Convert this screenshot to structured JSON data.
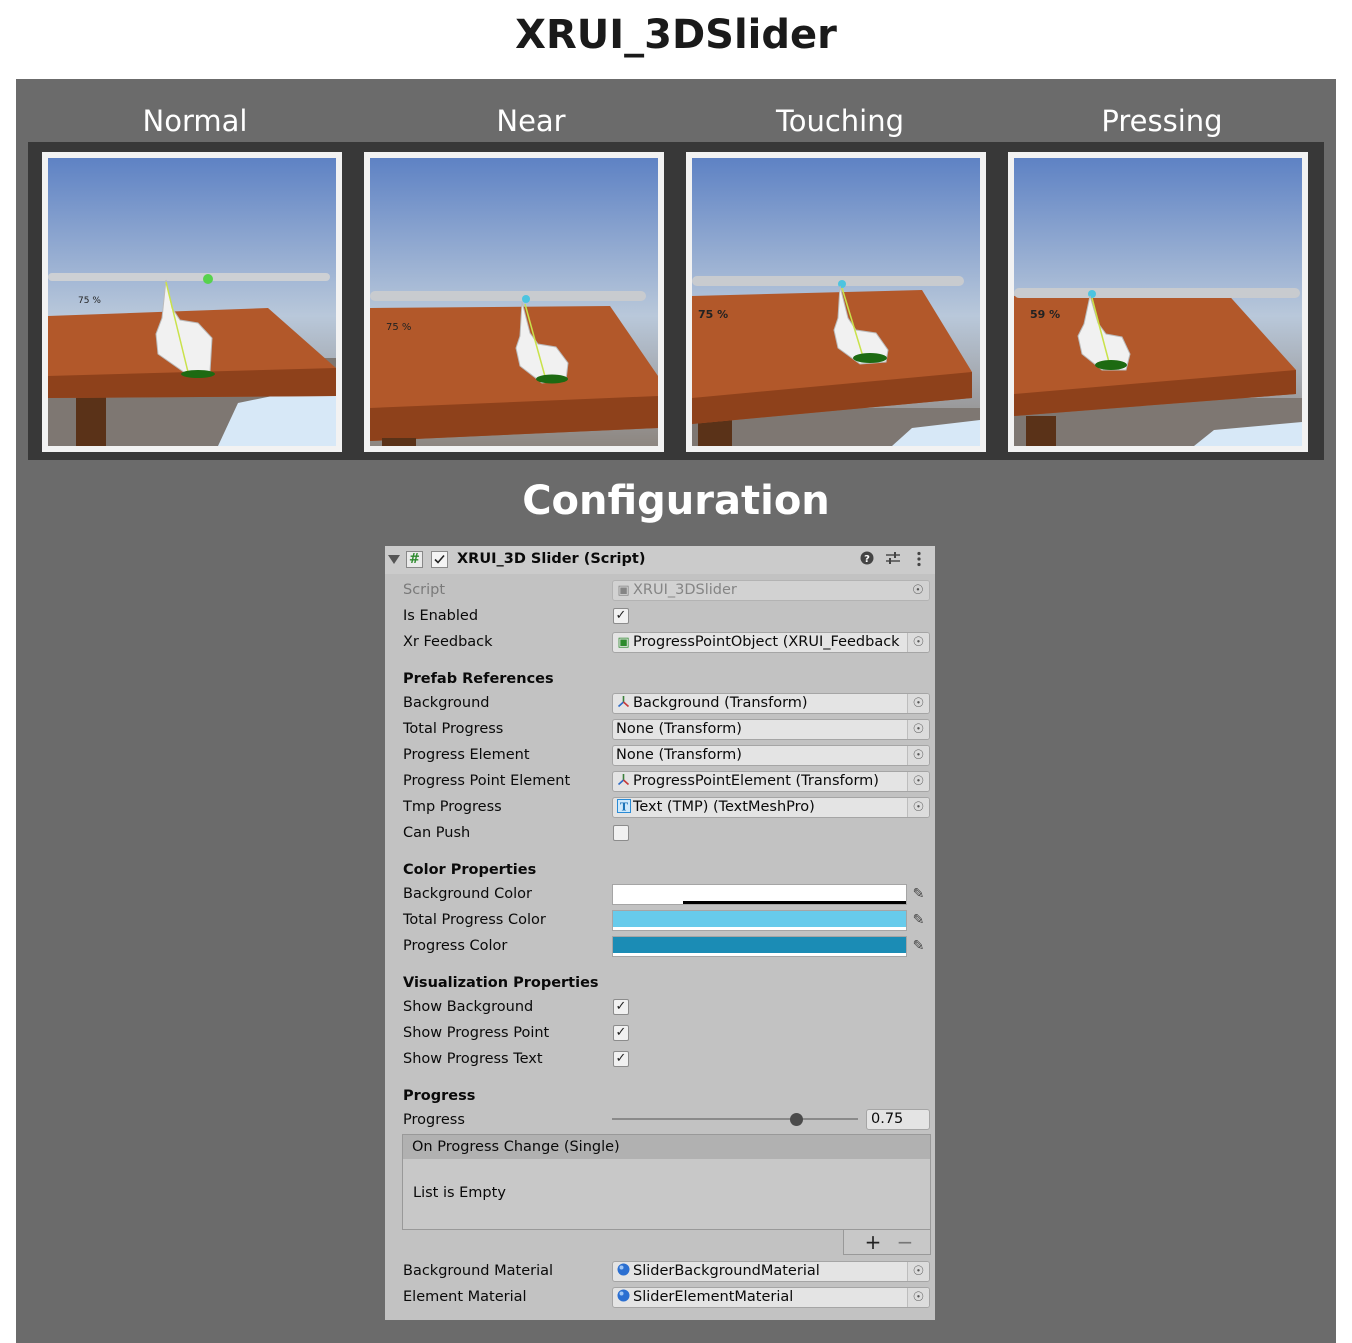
{
  "page_title": "XRUI_3DSlider",
  "states": [
    {
      "label": "Normal",
      "percent_text": "75 %",
      "progress": 0.75
    },
    {
      "label": "Near",
      "percent_text": "75 %",
      "progress": 0.75
    },
    {
      "label": "Touching",
      "percent_text": "75 %",
      "progress": 0.75
    },
    {
      "label": "Pressing",
      "percent_text": "59 %",
      "progress": 0.59
    }
  ],
  "configuration_title": "Configuration",
  "inspector": {
    "header": {
      "hash": "#",
      "title": "XRUI_3D Slider (Script)",
      "help_icon": "help-icon",
      "preset_icon": "sliders-icon",
      "menu_icon": "kebab-menu-icon"
    },
    "script": {
      "label": "Script",
      "value": "XRUI_3DSlider"
    },
    "is_enabled": {
      "label": "Is Enabled",
      "checked": true
    },
    "xr_feedback": {
      "label": "Xr Feedback",
      "value": "ProgressPointObject (XRUI_Feedback"
    },
    "prefab_references": {
      "title": "Prefab References",
      "background": {
        "label": "Background",
        "value": "Background (Transform)"
      },
      "total_progress": {
        "label": "Total Progress",
        "value": "None (Transform)"
      },
      "progress_element": {
        "label": "Progress Element",
        "value": "None (Transform)"
      },
      "progress_point_element": {
        "label": "Progress Point Element",
        "value": "ProgressPointElement (Transform)"
      },
      "tmp_progress": {
        "label": "Tmp Progress",
        "value": "Text (TMP) (TextMeshPro)"
      },
      "can_push": {
        "label": "Can Push",
        "checked": false
      }
    },
    "color_properties": {
      "title": "Color Properties",
      "background_color": {
        "label": "Background Color",
        "color": "#ffffff",
        "alpha": 0.24
      },
      "total_progress_color": {
        "label": "Total Progress Color",
        "color": "#67cbeb",
        "alpha": 1.0
      },
      "progress_color": {
        "label": "Progress Color",
        "color": "#1b8cb5",
        "alpha": 1.0
      }
    },
    "visualization_properties": {
      "title": "Visualization Properties",
      "show_background": {
        "label": "Show Background",
        "checked": true
      },
      "show_progress_point": {
        "label": "Show Progress Point",
        "checked": true
      },
      "show_progress_text": {
        "label": "Show Progress Text",
        "checked": true
      }
    },
    "progress": {
      "title": "Progress",
      "label": "Progress",
      "value": 0.75,
      "value_text": "0.75",
      "event_title": "On Progress Change (Single)",
      "event_empty": "List is Empty",
      "add": "+",
      "remove": "−"
    },
    "background_material": {
      "label": "Background Material",
      "value": "SliderBackgroundMaterial"
    },
    "element_material": {
      "label": "Element Material",
      "value": "SliderElementMaterial"
    }
  },
  "colors": {
    "panel": "#6b6b6b",
    "strip": "#383838",
    "inspector": "#c2c2c2"
  }
}
